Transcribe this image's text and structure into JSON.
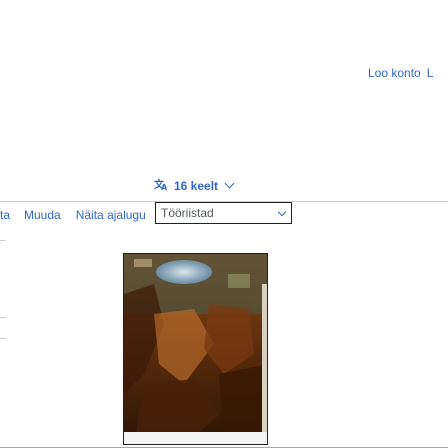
{
  "header": {
    "account_link": "Loo konto",
    "account_link_tail": "L"
  },
  "language_selector": {
    "icon": "translate-icon",
    "label": "16 keelt"
  },
  "tabs": {
    "cut_label": "ta",
    "edit": "Muuda",
    "history": "Näita ajalugu",
    "tools": "Tööriistad"
  },
  "colors": {
    "link": "#3366cc",
    "tab_border": "#a7d7f9",
    "frame_border": "#202122"
  },
  "image": {
    "description_icon": "photo-thumbnail"
  }
}
